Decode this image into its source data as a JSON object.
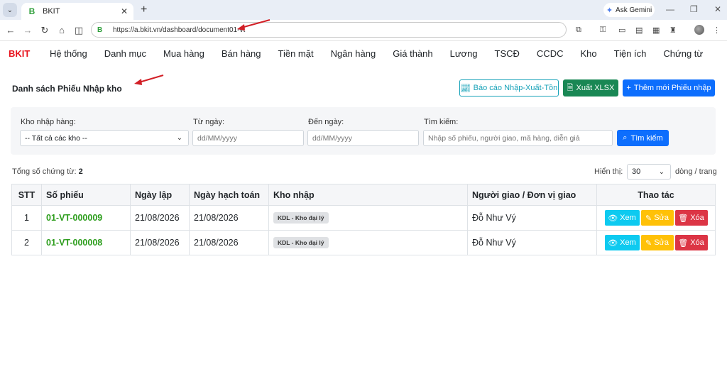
{
  "browser": {
    "tab_title": "BKIT",
    "favicon_letter": "B",
    "url": "https://a.bkit.vn/dashboard/document01-vt",
    "gemini_label": "Ask Gemini"
  },
  "app": {
    "brand": "BKIT",
    "brand_color": "#e8141e",
    "menu": [
      "Hệ thống",
      "Danh mục",
      "Mua hàng",
      "Bán hàng",
      "Tiền mặt",
      "Ngân hàng",
      "Giá thành",
      "Lương",
      "TSCĐ",
      "CCDC",
      "Kho",
      "Tiện ích",
      "Chứng từ"
    ]
  },
  "page": {
    "title": "Danh sách Phiếu Nhập kho",
    "btn_report": "Báo cáo Nhập-Xuất-Tồn",
    "btn_export": "Xuất XLSX",
    "btn_add": "Thêm mới Phiếu nhập"
  },
  "filters": {
    "warehouse_label": "Kho nhập hàng:",
    "warehouse_value": "-- Tất cả các kho --",
    "from_label": "Từ ngày:",
    "from_placeholder": "dd/MM/yyyy",
    "to_label": "Đến ngày:",
    "to_placeholder": "dd/MM/yyyy",
    "search_label": "Tìm kiếm:",
    "search_placeholder": "Nhập số phiếu, người giao, mã hàng, diễn giả",
    "search_button": "Tìm kiếm"
  },
  "summary": {
    "total_label": "Tổng số chứng từ:",
    "total_count": "2",
    "perpage_label": "Hiển thị:",
    "perpage_value": "30",
    "perpage_unit": "dòng / trang"
  },
  "table": {
    "headers": [
      "STT",
      "Số phiếu",
      "Ngày lập",
      "Ngày hạch toán",
      "Kho nhập",
      "Người giao / Đơn vị giao",
      "Thao tác"
    ],
    "rows": [
      {
        "stt": "1",
        "doc_no": "01-VT-000009",
        "created": "21/08/2026",
        "posted": "21/08/2026",
        "warehouse": "KDL - Kho đại lý",
        "deliverer": "Đỗ Như Vý"
      },
      {
        "stt": "2",
        "doc_no": "01-VT-000008",
        "created": "21/08/2026",
        "posted": "21/08/2026",
        "warehouse": "KDL - Kho đại lý",
        "deliverer": "Đỗ Như Vý"
      }
    ],
    "action_view": "Xem",
    "action_edit": "Sửa",
    "action_delete": "Xóa"
  }
}
